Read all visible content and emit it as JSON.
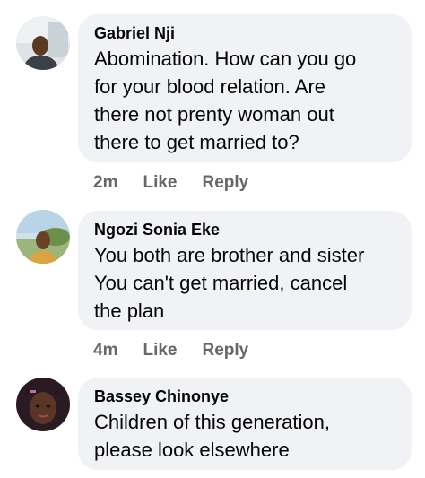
{
  "comments": [
    {
      "author": "Gabriel Nji",
      "lines": [
        "Abomination. How can you go",
        "for your blood relation. Are",
        "there not prenty woman out",
        "there to get married to?"
      ],
      "time": "2m",
      "like_label": "Like",
      "reply_label": "Reply",
      "avatar_icon": "avatar-photo"
    },
    {
      "author": "Ngozi Sonia Eke",
      "lines": [
        "You both are brother and sister",
        "You can't get married, cancel",
        "the plan"
      ],
      "time": "4m",
      "like_label": "Like",
      "reply_label": "Reply",
      "avatar_icon": "avatar-photo"
    },
    {
      "author": "Bassey Chinonye",
      "lines": [
        "Children of this generation,",
        "please look elsewhere"
      ],
      "avatar_icon": "avatar-photo"
    }
  ],
  "colors": {
    "bubble_bg": "#f0f2f5",
    "action_text": "#65676b",
    "author_text": "#050505"
  }
}
